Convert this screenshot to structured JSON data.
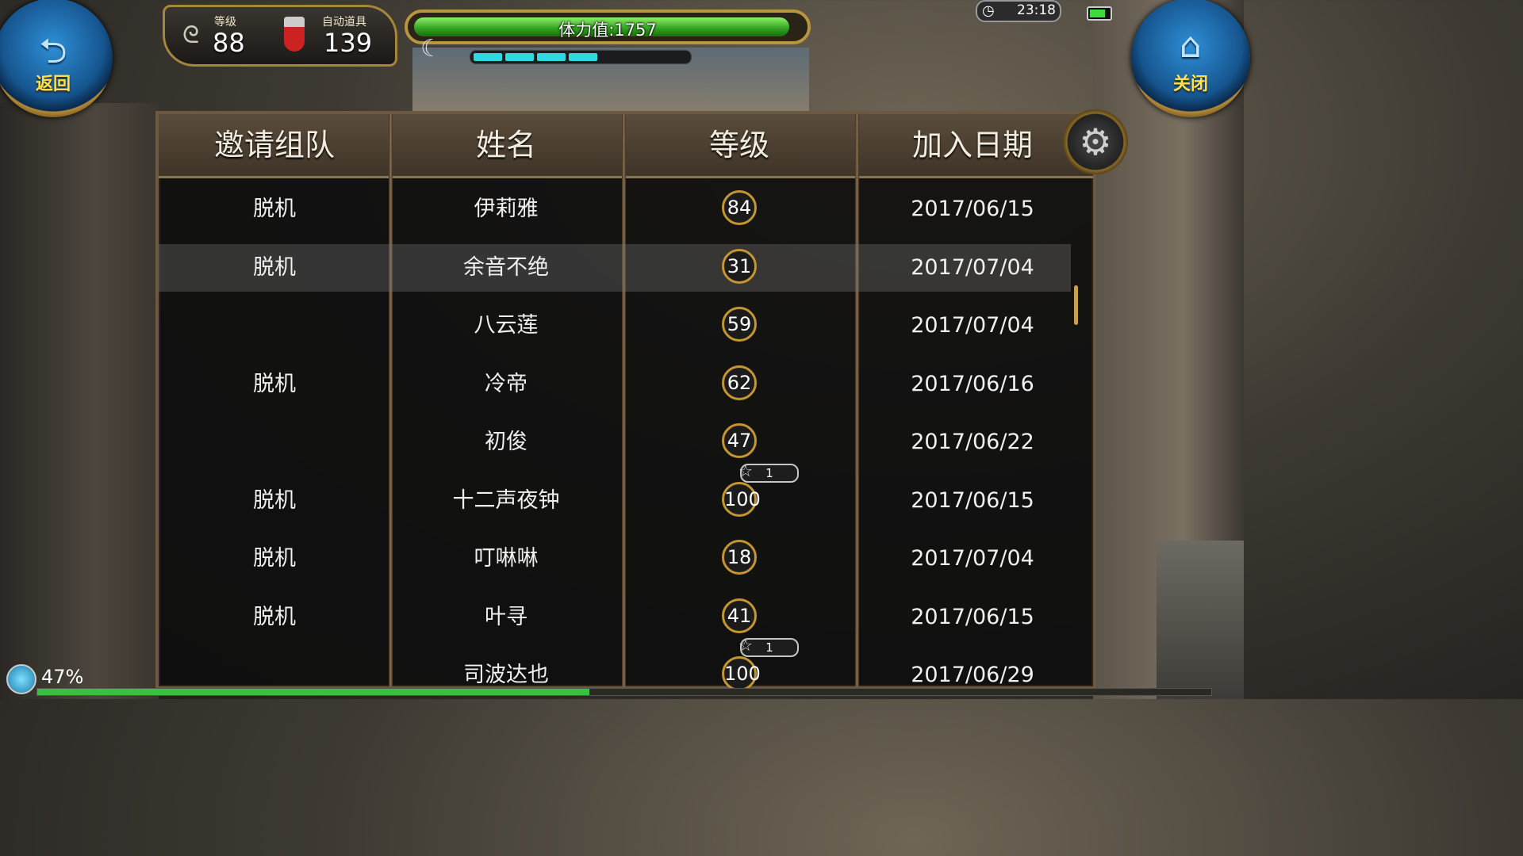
{
  "hud": {
    "back_label": "返回",
    "close_label": "关闭",
    "level_caption": "等级",
    "level_value": "88",
    "auto_item_caption": "自动道具",
    "auto_item_value": "139",
    "stamina_text": "体力值:1757",
    "stamina_fill_fraction": 0.97,
    "energy_segments_filled": 4,
    "energy_segments_total": 7,
    "clock": "23:18",
    "battery_fraction": 0.8
  },
  "table": {
    "headers": [
      "邀请组队",
      "姓名",
      "等级",
      "加入日期"
    ],
    "rows": [
      {
        "status": "脱机",
        "name": "伊莉雅",
        "level": "84",
        "date": "2017/06/15",
        "stars": ""
      },
      {
        "status": "脱机",
        "name": "余音不绝",
        "level": "31",
        "date": "2017/07/04",
        "stars": ""
      },
      {
        "status": "",
        "name": "八云莲",
        "level": "59",
        "date": "2017/07/04",
        "stars": ""
      },
      {
        "status": "脱机",
        "name": "冷帝",
        "level": "62",
        "date": "2017/06/16",
        "stars": ""
      },
      {
        "status": "",
        "name": "初俊",
        "level": "47",
        "date": "2017/06/22",
        "stars": ""
      },
      {
        "status": "脱机",
        "name": "十二声夜钟",
        "level": "100",
        "date": "2017/06/15",
        "stars": "1"
      },
      {
        "status": "脱机",
        "name": "叮啉啉",
        "level": "18",
        "date": "2017/07/04",
        "stars": ""
      },
      {
        "status": "脱机",
        "name": "叶寻",
        "level": "41",
        "date": "2017/06/15",
        "stars": ""
      },
      {
        "status": "",
        "name": "司波达也",
        "level": "100",
        "date": "2017/06/29",
        "stars": "1"
      }
    ],
    "selected_row": 1
  },
  "footer": {
    "exp_percent_text": "47%",
    "exp_fraction": 0.47
  },
  "icons": {
    "back": "back-arrow-icon",
    "close": "home-icon",
    "settings": "gear-icon",
    "level": "swirl-icon",
    "auto_item": "potion-icon",
    "clock": "clock-icon",
    "star": "star-icon"
  }
}
